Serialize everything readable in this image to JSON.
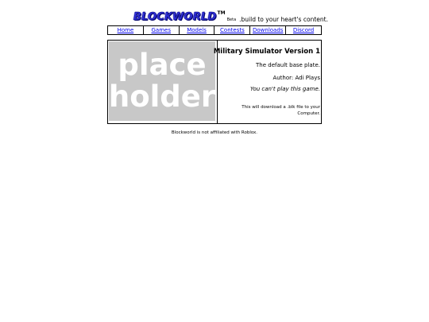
{
  "header": {
    "logo": "BLOCKWORLD",
    "tm": "TM",
    "beta": "Beta",
    "tagline": ".build to your heart's content."
  },
  "nav": [
    {
      "label": "Home"
    },
    {
      "label": "Games"
    },
    {
      "label": "Models"
    },
    {
      "label": "Contests"
    },
    {
      "label": "Downloads"
    },
    {
      "label": "Discord"
    }
  ],
  "game": {
    "placeholder_line1": "place",
    "placeholder_line2": "holder",
    "title": "Military Simulator Version 1",
    "description": "The default base plate.",
    "author": "Author: Adi Plays",
    "play_note": "You can't play this game.",
    "download_note": "This will download a .blk file to your Computer."
  },
  "footer": {
    "disclaimer": "Blockworld is not affiliated with Roblox."
  },
  "colors": {
    "link": "#0000ee",
    "logo": "#2f2fd8",
    "placeholder_bg": "#c8c8c8"
  }
}
